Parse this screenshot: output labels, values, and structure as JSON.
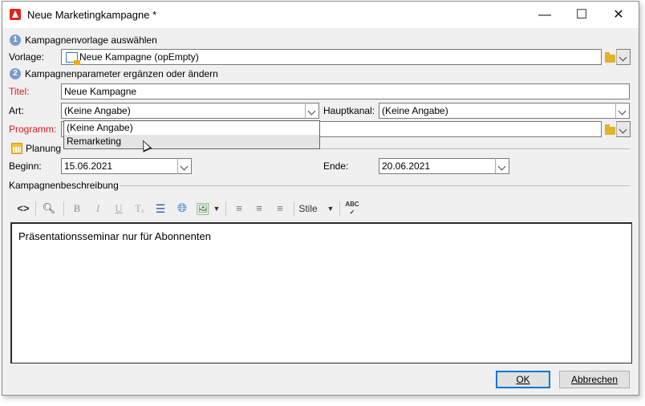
{
  "window": {
    "title": "Neue Marketingkampagne *",
    "minimize": "—",
    "maximize": "☐",
    "close": "✕"
  },
  "step1": {
    "number": "1",
    "heading": "Kampagnenvorlage auswählen"
  },
  "vorlage": {
    "label": "Vorlage:",
    "value": "Neue Kampagne (opEmpty)"
  },
  "step2": {
    "number": "2",
    "heading": "Kampagnenparameter ergänzen oder ändern"
  },
  "titel": {
    "label": "Titel:",
    "value": "Neue Kampagne"
  },
  "art": {
    "label": "Art:",
    "value": "(Keine Angabe)",
    "options": [
      "(Keine Angabe)",
      "Remarketing"
    ]
  },
  "hauptkanal": {
    "label": "Hauptkanal:",
    "value": "(Keine Angabe)"
  },
  "programm": {
    "label": "Programm:",
    "value": ""
  },
  "planung": {
    "heading": "Planung"
  },
  "beginn": {
    "label": "Beginn:",
    "value": "15.06.2021"
  },
  "ende": {
    "label": "Ende:",
    "value": "20.06.2021"
  },
  "beschreibung": {
    "heading": "Kampagnenbeschreibung",
    "text": "Präsentationsseminar nur für Abonnenten",
    "stile_label": "Stile"
  },
  "buttons": {
    "ok": "OK",
    "cancel": "Abbrechen"
  },
  "colors": {
    "required_label": "#e0191f",
    "default_button_border": "#0078d7"
  }
}
